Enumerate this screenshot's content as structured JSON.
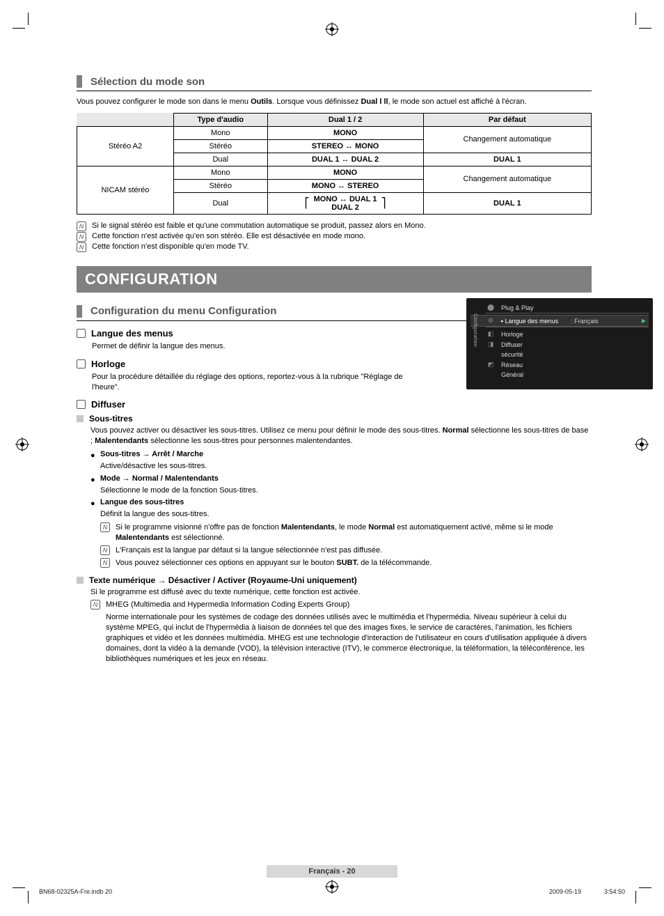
{
  "section1": {
    "heading": "Sélection du mode son",
    "intro_pre": "Vous pouvez configurer le mode son dans le menu ",
    "intro_tools": "Outils",
    "intro_mid": ". Lorsque vous définissez ",
    "intro_dual": "Dual l ll",
    "intro_post": ", le mode son actuel est affiché à l'écran."
  },
  "table": {
    "headers": {
      "c1": "Type d'audio",
      "c2": "Dual 1 / 2",
      "c3": "Par défaut"
    },
    "rows": {
      "a2_label": "Stéréo A2",
      "a2_mono_t": "Mono",
      "a2_mono_v": "MONO",
      "a2_stereo_t": "Stéréo",
      "a2_stereo_v": "STEREO ↔ MONO",
      "a2_auto": "Changement automatique",
      "a2_dual_t": "Dual",
      "a2_dual_v": "DUAL 1 ↔ DUAL 2",
      "a2_dual_d": "DUAL 1",
      "ni_label": "NICAM stéréo",
      "ni_mono_t": "Mono",
      "ni_mono_v": "MONO",
      "ni_stereo_t": "Stéréo",
      "ni_stereo_v": "MONO ↔ STEREO",
      "ni_auto": "Changement automatique",
      "ni_dual_t": "Dual",
      "ni_dual_v1": "MONO ↔ DUAL 1",
      "ni_dual_v2": "DUAL 2",
      "ni_dual_d": "DUAL 1"
    }
  },
  "notes1": [
    "Si le signal stéréo est faible et qu'une commutation automatique se produit, passez alors en Mono.",
    "Cette fonction n'est activée qu'en son stéréo. Elle est désactivée en mode mono.",
    "Cette fonction n'est disponible qu'en mode TV."
  ],
  "banner": "CONFIGURATION",
  "section2": {
    "heading": "Configuration du menu Configuration"
  },
  "q": {
    "langue": {
      "title": "Langue des menus",
      "desc": "Permet de définir la langue des menus."
    },
    "horloge": {
      "title": "Horloge",
      "desc": "Pour la procédure détaillée du réglage des options, reportez-vous à la rubrique \"Réglage de l'heure\"."
    },
    "diffuser": {
      "title": "Diffuser"
    }
  },
  "soustitres": {
    "title": "Sous-titres",
    "desc_pre": "Vous pouvez activer ou désactiver les sous-titres. Utilisez ce menu pour définir le mode des sous-titres. ",
    "desc_normal": "Normal",
    "desc_mid": " sélectionne les sous-titres de base ; ",
    "desc_mal": "Malentendants",
    "desc_post": " sélectionne les sous-titres pour personnes malentendantes.",
    "b1_t": "Sous-titres → Arrêt / Marche",
    "b1_d": "Active/désactive les sous-titres.",
    "b2_t": "Mode → Normal / Malentendants",
    "b2_d": "Sélectionne le mode de la fonction Sous-titres.",
    "b3_t": "Langue des sous-titres",
    "b3_d": "Définit la langue des sous-titres.",
    "n1_pre": "Si le programme visionné n'offre pas de fonction ",
    "n1_mal": "Malentendants",
    "n1_mid": ", le mode ",
    "n1_norm": "Normal",
    "n1_mid2": " est automatiquement activé, même si le mode ",
    "n1_mal2": "Malentendants",
    "n1_post": " est sélectionné.",
    "n2": "L'Français est la langue par défaut si la langue sélectionnée n'est pas diffusée.",
    "n3_pre": "Vous pouvez sélectionner ces options en appuyant sur le bouton ",
    "n3_btn": "SUBT.",
    "n3_post": " de la télécommande."
  },
  "texte": {
    "title": "Texte numérique → Désactiver / Activer (Royaume-Uni uniquement)",
    "desc": "Si le programme est diffusé avec du texte numérique, cette fonction est activée.",
    "n_head": "MHEG (Multimedia and Hypermedia Information Coding Experts Group)",
    "n_body": "Norme internationale pour les systèmes de codage des données utilisés avec le multimédia et l'hypermédia. Niveau supérieur à celui du système MPEG, qui inclut de l'hypermédia à liaison de données tel que des images fixes, le service de caractères, l'animation, les fichiers graphiques et vidéo et les données multimédia. MHEG est une technologie d'interaction de l'utilisateur en cours d'utilisation appliquée à divers domaines, dont la vidéo à la demande (VOD), la télévision interactive (ITV), le commerce électronique, la téléformation, la téléconférence, les bibliothèques numériques et les jeux en réseau."
  },
  "osd": {
    "side": "Configuration",
    "r0": "Plug & Play",
    "r1": "Langue des menus",
    "r1v": ": Français",
    "r2": "Horloge",
    "r3": "Diffuser",
    "r4": "sécurité",
    "r5": "Réseau",
    "r6": "Général"
  },
  "footer": {
    "page_label": "Français - 20",
    "left": "BN68-02325A-Fre.indb   20",
    "date": "2009-05-19",
    "time": "3:54:50"
  }
}
